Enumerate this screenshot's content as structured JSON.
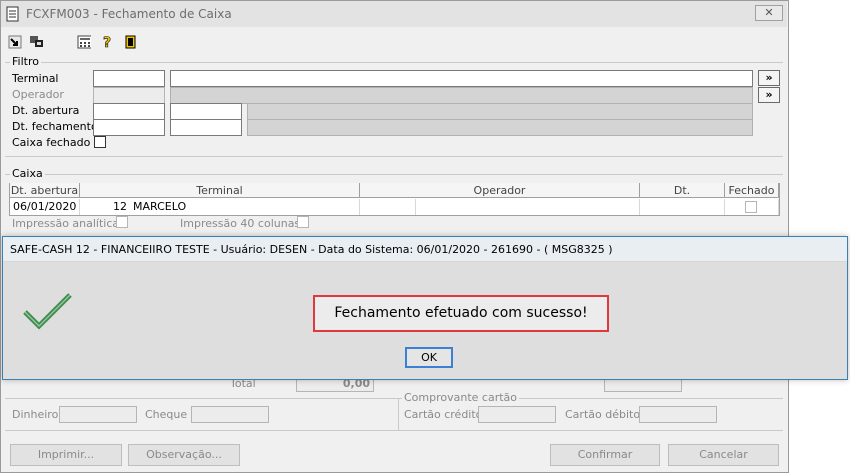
{
  "window": {
    "title": "FCXFM003 - Fechamento de Caixa",
    "close": "✕"
  },
  "filtro": {
    "title": "Filtro",
    "terminal_label": "Terminal",
    "operador_label": "Operador",
    "dt_abertura_label": "Dt. abertura",
    "dt_fechamento_label": "Dt. fechamento",
    "caixa_fechado_label": "Caixa fechado",
    "lookup": "»"
  },
  "caixa": {
    "title": "Caixa",
    "columns": [
      "Dt. abertura",
      "Terminal",
      "Operador",
      "Dt. fechamento",
      "Fechado"
    ],
    "row": {
      "dt_abertura": "06/01/2020",
      "terminal_num": "12",
      "terminal_name": "MARCELO"
    },
    "impressao_analitica": "Impressão analítica",
    "impressao_40": "Impressão 40 colunas"
  },
  "totals": {
    "total_label": "Total",
    "total_value": "0,00"
  },
  "pagamentos": {
    "dinheiro": "Dinheiro",
    "cheque": "Cheque",
    "comprovante_title": "Comprovante cartão",
    "cartao_credito": "Cartão crédito",
    "cartao_debito": "Cartão débito"
  },
  "buttons": {
    "imprimir": "Imprimir...",
    "observacao": "Observação...",
    "confirmar": "Confirmar",
    "cancelar": "Cancelar"
  },
  "dialog": {
    "title": "SAFE-CASH 12 - FINANCEIIRO TESTE - Usuário: DESEN - Data do Sistema: 06/01/2020 - 261690 - ( MSG8325 )",
    "message": "Fechamento efetuado com sucesso!",
    "ok": "OK"
  },
  "colors": {
    "check": "#3f8a4e",
    "highlight": "#e0383c",
    "focus": "#3c7fd6"
  }
}
